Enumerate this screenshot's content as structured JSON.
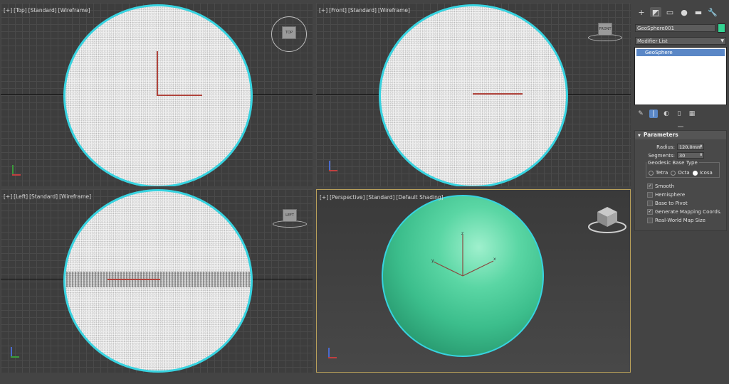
{
  "viewports": {
    "top": {
      "bracket": "[+]",
      "view": "[Top]",
      "standard": "[Standard]",
      "mode": "[Wireframe]"
    },
    "front": {
      "bracket": "[+]",
      "view": "[Front]",
      "standard": "[Standard]",
      "mode": "[Wireframe]"
    },
    "left": {
      "bracket": "[+]",
      "view": "[Left]",
      "standard": "[Standard]",
      "mode": "[Wireframe]"
    },
    "persp": {
      "bracket": "[+]",
      "view": "[Perspective]",
      "standard": "[Standard]",
      "mode": "[Default Shading]"
    },
    "axes": {
      "x": "x",
      "y": "y",
      "z": "z"
    },
    "viewcube": {
      "top": "TOP",
      "front": "FRONT",
      "left": "LEFT"
    }
  },
  "panel": {
    "tabs": [
      {
        "icon": "create-icon",
        "glyph": "+"
      },
      {
        "icon": "modify-icon",
        "glyph": "◩"
      },
      {
        "icon": "hierarchy-icon",
        "glyph": "▭"
      },
      {
        "icon": "motion-icon",
        "glyph": "●"
      },
      {
        "icon": "display-icon",
        "glyph": "▬"
      },
      {
        "icon": "utilities-icon",
        "glyph": "🔧"
      }
    ],
    "object_name": "GeoSphere001",
    "object_color": "#33d493",
    "modifier_list": "Modifier List",
    "stack": [
      "GeoSphere"
    ],
    "parameters": {
      "title": "Parameters",
      "radius_label": "Radius:",
      "radius_value": "120,0mm",
      "segments_label": "Segments:",
      "segments_value": "30",
      "base_type_label": "Geodesic Base Type",
      "base_types": [
        "Tetra",
        "Octa",
        "Icosa"
      ],
      "base_type_selected": "Icosa",
      "smooth": "Smooth",
      "smooth_checked": true,
      "hemisphere": "Hemisphere",
      "hemisphere_checked": false,
      "base_to_pivot": "Base to Pivot",
      "base_to_pivot_checked": false,
      "gen_mapping": "Generate Mapping Coords.",
      "gen_mapping_checked": true,
      "real_world": "Real-World Map Size",
      "real_world_checked": false
    }
  },
  "colors": {
    "selection_outline": "#37d3e0",
    "sphere_green": "#3cbe8c",
    "active_viewport_border": "#b9a05a",
    "stack_highlight": "#5a87c6"
  }
}
